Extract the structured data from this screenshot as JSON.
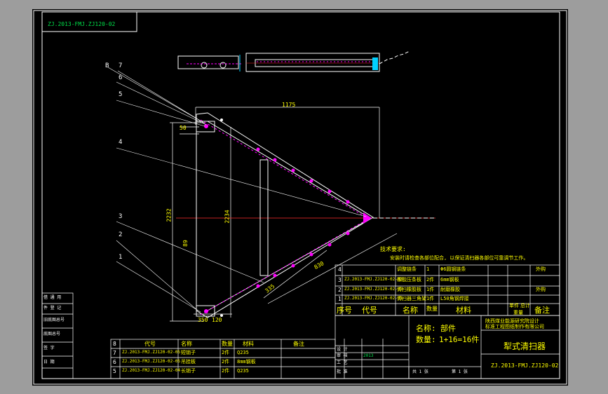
{
  "drawing_number_top": "ZJ.2013-FMJ.ZJ120-02",
  "callouts": [
    "7",
    "6",
    "5",
    "4",
    "3",
    "2",
    "1",
    "B"
  ],
  "dimensions": {
    "overall_length": "1175",
    "height_left": "2232",
    "height_mid": "2234",
    "short_a": "50",
    "short_b": "120",
    "short_c": "89",
    "slant_1": "335",
    "slant_2": "830",
    "bottom_a": "350",
    "bottom_b": "120"
  },
  "tech_notes": {
    "title": "技术要求:",
    "line1": "安装时请检查各部位配合, 以保证清扫器各部位可靠调节工作。"
  },
  "bom_upper": [
    {
      "no": "4",
      "code": "",
      "name": "调整链条",
      "qty": "1",
      "material": "Φ6圆钢链条",
      "remark": "外购"
    },
    {
      "no": "3",
      "code": "ZJ.2013-FMJ.ZJ120-02-03",
      "name": "橡胶压条板",
      "qty": "2件",
      "material": "6mm钢板",
      "remark": ""
    },
    {
      "no": "2",
      "code": "ZJ.2013-FMJ.ZJ120-02-02",
      "name": "清扫橡胶板",
      "qty": "1件",
      "material": "耐磨橡胶",
      "remark": "外购"
    },
    {
      "no": "1",
      "code": "ZJ.2013-FMJ.ZJ120-02-01",
      "name": "清扫器三角架",
      "qty": "1件",
      "material": "L50角钢焊接",
      "remark": ""
    }
  ],
  "bom_upper_header": {
    "no": "序号",
    "code": "代号",
    "name": "名称",
    "qty": "数量",
    "material": "材料",
    "unit_w": "单件",
    "total_w": "总计",
    "weight": "重量",
    "remark": "备注"
  },
  "bom_lower": [
    {
      "no": "8",
      "code": "",
      "name": "",
      "qty": "",
      "material": "",
      "remark": ""
    },
    {
      "no": "7",
      "code": "ZJ.2013-FMJ.ZJ120-02-05",
      "name": "短销子",
      "qty": "2件",
      "material": "Q235",
      "remark": ""
    },
    {
      "no": "6",
      "code": "ZJ.2013-FMJ.ZJ120-02-05",
      "name": "吊挂板",
      "qty": "2件",
      "material": "8mm钢板",
      "remark": ""
    },
    {
      "no": "5",
      "code": "ZJ.2013-FMJ.ZJ120-02-04",
      "name": "长销子",
      "qty": "2件",
      "material": "Q235",
      "remark": ""
    }
  ],
  "bom_lower_header": {
    "no": "序号",
    "code": "代号",
    "name": "名称",
    "qty": "数量",
    "material": "材料",
    "remark": "备注"
  },
  "title_block": {
    "part_label": "名称:",
    "part_type": "部件",
    "qty_label": "数量:",
    "qty_value": "1+16=16件",
    "company_1": "陕西煤业能源研究院设计",
    "company_2": "标准工程图纸制作有限公司",
    "title": "犁式清扫器",
    "drawing_no": "ZJ.2013-FMJ.ZJ120-02",
    "design": "设 计",
    "check": "审 核",
    "process": "工 艺",
    "approve": "批 准",
    "date": "2013",
    "sheet_total": "共 1 张",
    "sheet_no": "第 1 张"
  },
  "left_stamp": [
    "借 通 用",
    "件 登 记",
    "旧底图总号",
    "底图总号",
    "签 字",
    "日 期"
  ],
  "colors": {
    "frame": "#ffffff",
    "object": "#ffffff",
    "centerline": "#ff2b2b",
    "hidden": "#ff00ff",
    "dimension": "#00d0ff",
    "callout_leader": "#ffffff",
    "text_yellow": "#ffff00",
    "text_green": "#00e04a"
  }
}
